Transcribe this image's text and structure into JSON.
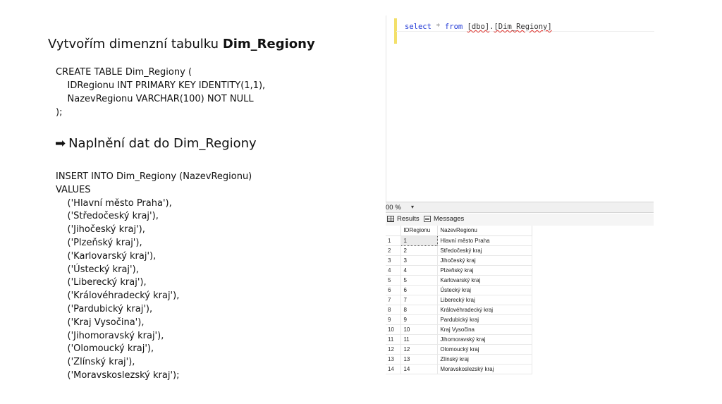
{
  "slide": {
    "heading_prefix": "Vytvořím dimenzní tabulku ",
    "heading_bold": "Dim_Regiony",
    "create_code": "CREATE TABLE Dim_Regiony (\n    IDRegionu INT PRIMARY KEY IDENTITY(1,1),\n    NazevRegionu VARCHAR(100) NOT NULL\n);",
    "arrow_symbol": "➡",
    "section_title": "Naplnění dat do Dim_Regiony",
    "insert_code": "INSERT INTO Dim_Regiony (NazevRegionu)\nVALUES\n    ('Hlavní město Praha'),\n    ('Středočeský kraj'),\n    ('Jihočeský kraj'),\n    ('Plzeňský kraj'),\n    ('Karlovarský kraj'),\n    ('Ústecký kraj'),\n    ('Liberecký kraj'),\n    ('Královéhradecký kraj'),\n    ('Pardubický kraj'),\n    ('Kraj Vysočina'),\n    ('Jihomoravský kraj'),\n    ('Olomoucký kraj'),\n    ('Zlínský kraj'),\n    ('Moravskoslezský kraj');"
  },
  "editor": {
    "kw_select": "select",
    "star": "*",
    "kw_from": "from",
    "schema": "[dbo]",
    "dot": ".",
    "table": "[Dim_Regiony]"
  },
  "zoom": {
    "value": "00 %",
    "dropdown_glyph": "▾"
  },
  "tabs": {
    "results": "Results",
    "messages": "Messages"
  },
  "results": {
    "columns": [
      "IDRegionu",
      "NazevRegionu"
    ],
    "rows": [
      [
        "1",
        "1",
        "Hlavní město Praha"
      ],
      [
        "2",
        "2",
        "Středočeský kraj"
      ],
      [
        "3",
        "3",
        "Jihočeský kraj"
      ],
      [
        "4",
        "4",
        "Plzeňský kraj"
      ],
      [
        "5",
        "5",
        "Karlovarský kraj"
      ],
      [
        "6",
        "6",
        "Ústecký kraj"
      ],
      [
        "7",
        "7",
        "Liberecký kraj"
      ],
      [
        "8",
        "8",
        "Královéhradecký kraj"
      ],
      [
        "9",
        "9",
        "Pardubický kraj"
      ],
      [
        "10",
        "10",
        "Kraj Vysočina"
      ],
      [
        "11",
        "11",
        "Jihomoravský kraj"
      ],
      [
        "12",
        "12",
        "Olomoucký kraj"
      ],
      [
        "13",
        "13",
        "Zlínský kraj"
      ],
      [
        "14",
        "14",
        "Moravskoslezský kraj"
      ]
    ]
  },
  "icons": {
    "results_tab": "grid-icon",
    "messages_tab": "messages-icon"
  }
}
